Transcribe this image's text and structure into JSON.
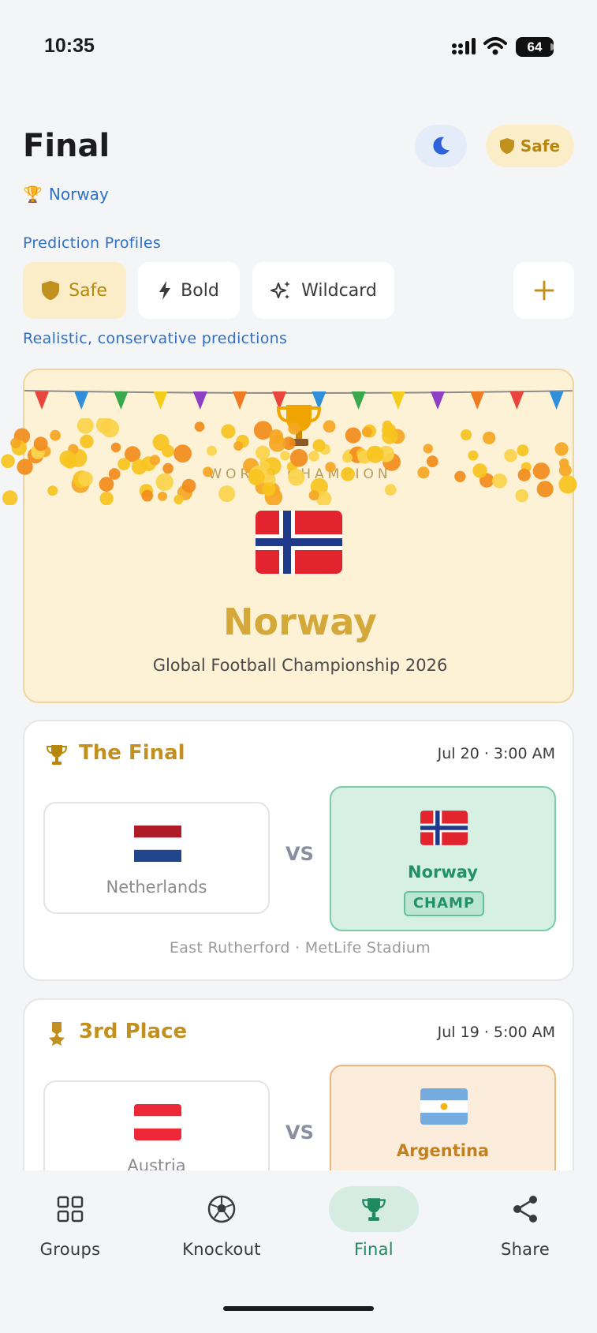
{
  "status": {
    "time": "10:35",
    "battery": "64"
  },
  "header": {
    "title": "Final",
    "profile_pill": "Safe",
    "champion_label": "Norway"
  },
  "profiles": {
    "label": "Prediction Profiles",
    "items": [
      {
        "label": "Safe",
        "icon": "shield-icon"
      },
      {
        "label": "Bold",
        "icon": "bolt-icon"
      },
      {
        "label": "Wildcard",
        "icon": "sparkles-icon"
      }
    ],
    "add_icon": "plus-icon",
    "description": "Realistic, conservative predictions"
  },
  "champion_card": {
    "label": "WORLD CHAMPION",
    "flag": "🇳🇴",
    "name": "Norway",
    "tournament": "Global Football Championship 2026"
  },
  "final_match": {
    "title": "The Final",
    "date": "Jul 20 · 3:00 AM",
    "home": {
      "name": "Netherlands",
      "flag": "🇳🇱"
    },
    "away": {
      "name": "Norway",
      "flag": "🇳🇴",
      "badge": "CHAMP"
    },
    "vs": "VS",
    "venue": "East Rutherford · MetLife Stadium"
  },
  "third_place": {
    "title": "3rd Place",
    "date": "Jul 19 · 5:00 AM",
    "home": {
      "name": "Austria",
      "flag": "🇦🇹"
    },
    "away": {
      "name": "Argentina",
      "flag": "🇦🇷"
    },
    "vs": "VS"
  },
  "nav": [
    {
      "label": "Groups",
      "icon": "grid-icon"
    },
    {
      "label": "Knockout",
      "icon": "soccer-ball-icon"
    },
    {
      "label": "Final",
      "icon": "trophy-icon",
      "active": true
    },
    {
      "label": "Share",
      "icon": "share-icon"
    }
  ],
  "colors": {
    "gold": "#c2901e",
    "blue": "#2f6fc9",
    "green": "#1d8a5f",
    "champ_bg": "#fdf2d6"
  }
}
